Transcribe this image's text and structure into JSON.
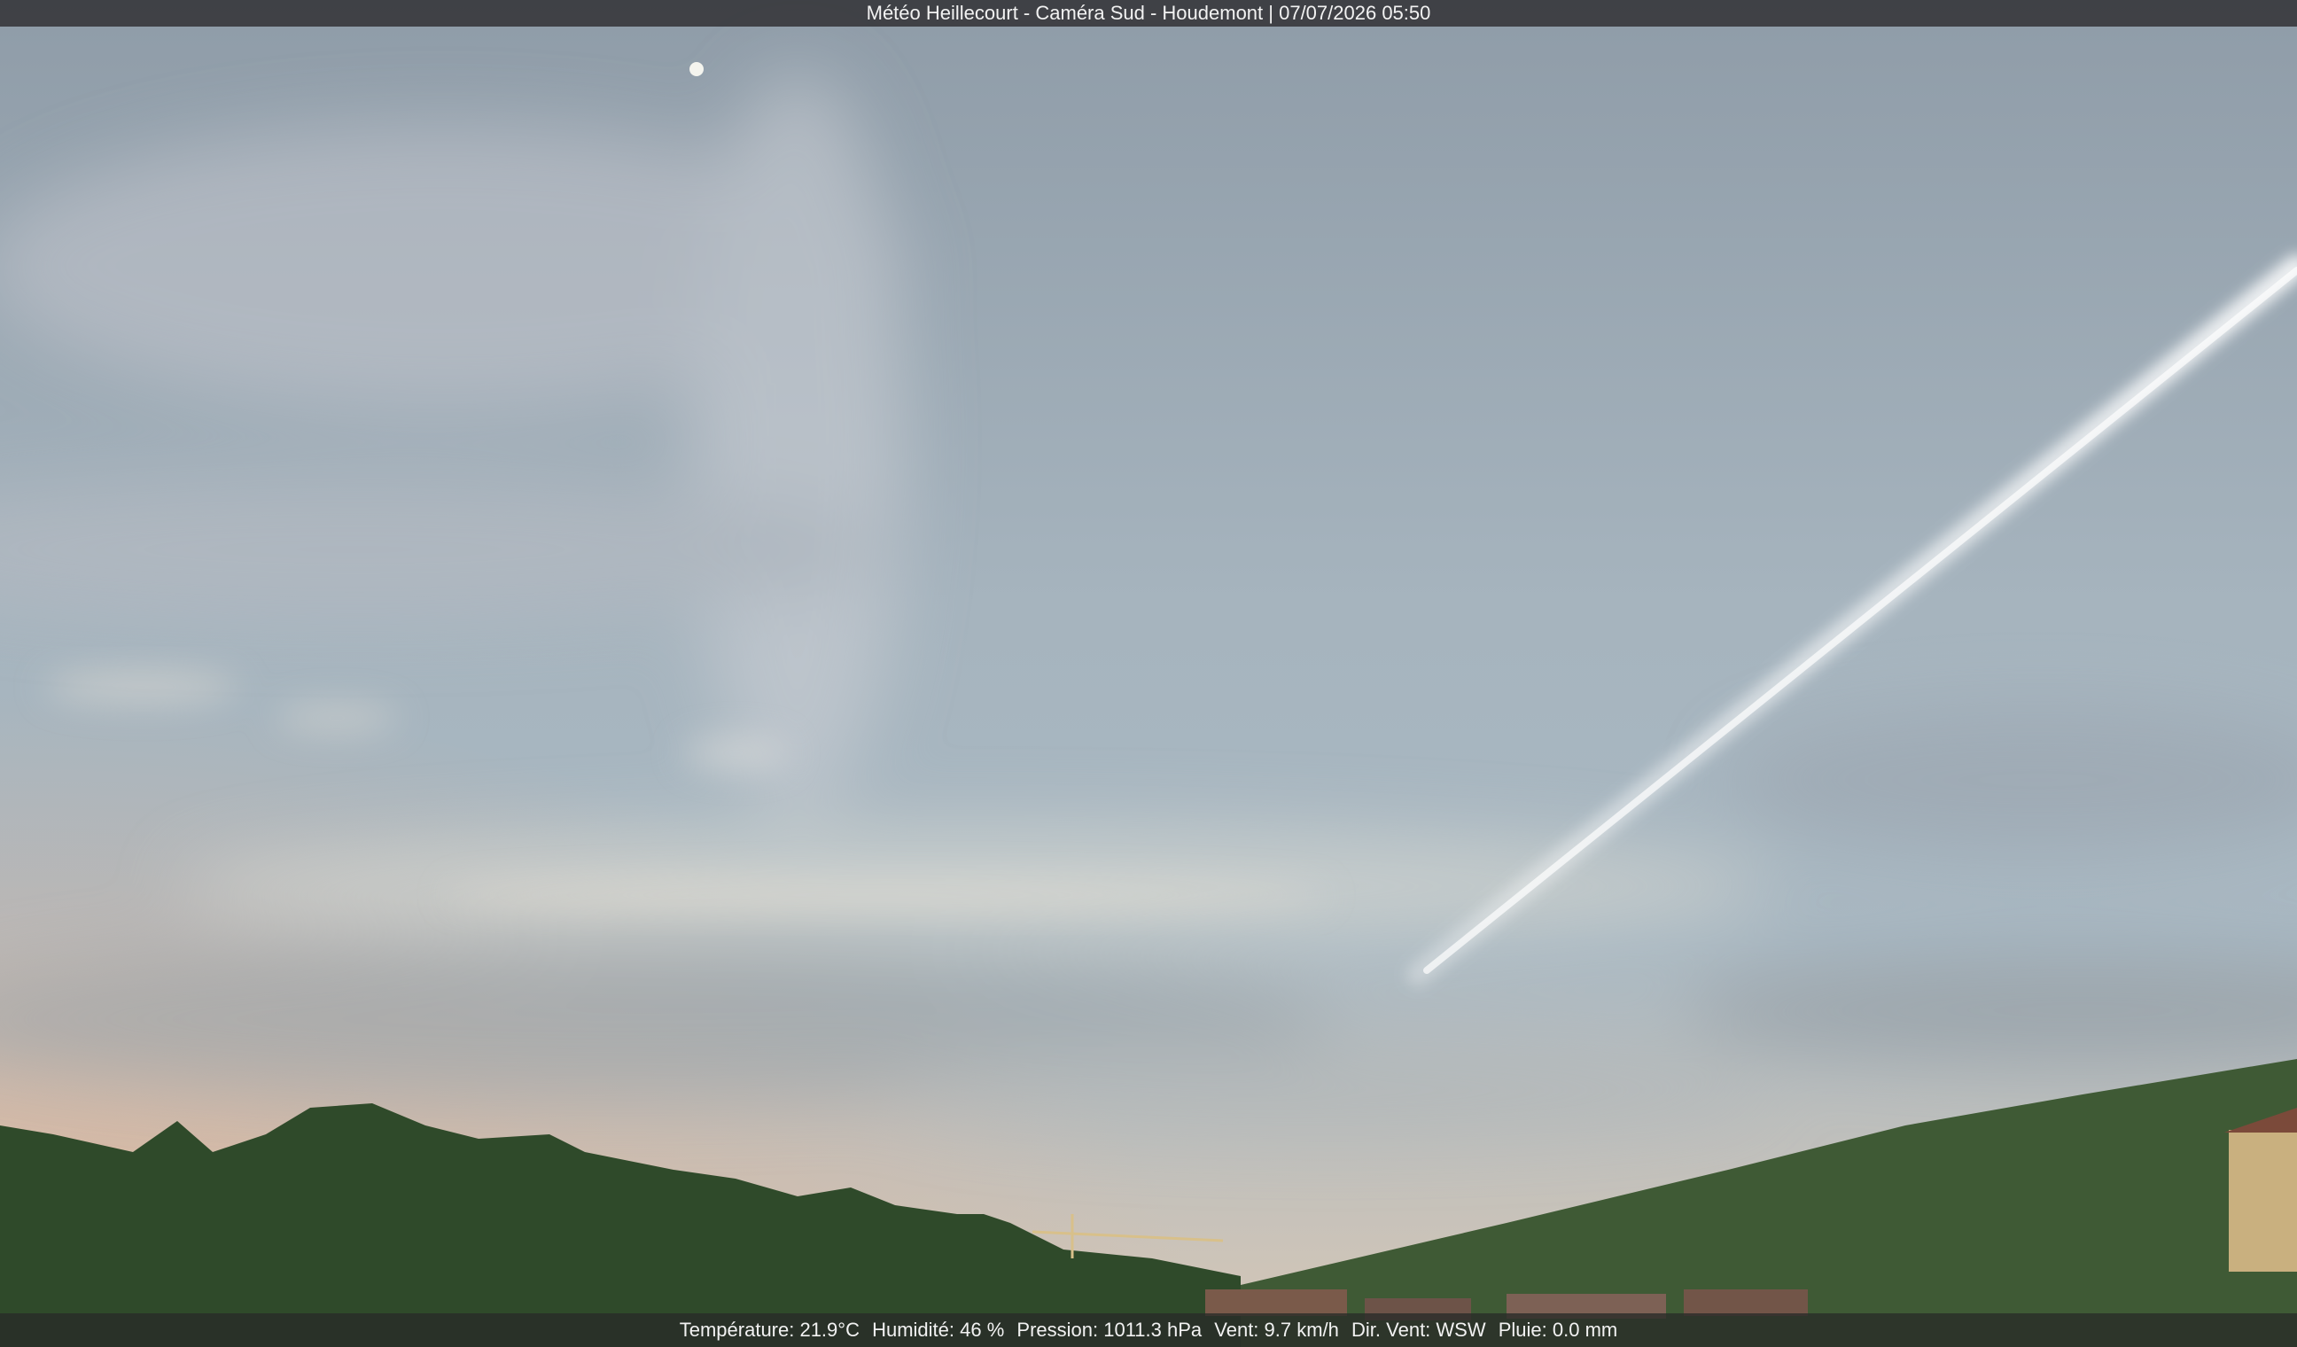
{
  "camera": {
    "title": "Météo Heillecourt - Caméra Sud - Houdemont | 07/07/2026 05:50"
  },
  "weather": {
    "temperature": "Température: 21.9°C",
    "humidity": "Humidité: 46 %",
    "pressure": "Pression: 1011.3 hPa",
    "wind_speed": "Vent: 9.7 km/h",
    "wind_direction": "Dir. Vent: WSW",
    "rain": "Pluie: 0.0 mm"
  },
  "scene": {
    "sky_top_color": "#8f9ca8",
    "sky_mid_color": "#a9b8c2",
    "sky_horizon_color": "#d6c7b6",
    "sunrise_glow_color": "#e3b597",
    "trees_color": "#2f4a2a",
    "hill_color": "#3f5a35",
    "contrail_color": "#f1f2f0",
    "moon_color": "#f4f4ee"
  }
}
